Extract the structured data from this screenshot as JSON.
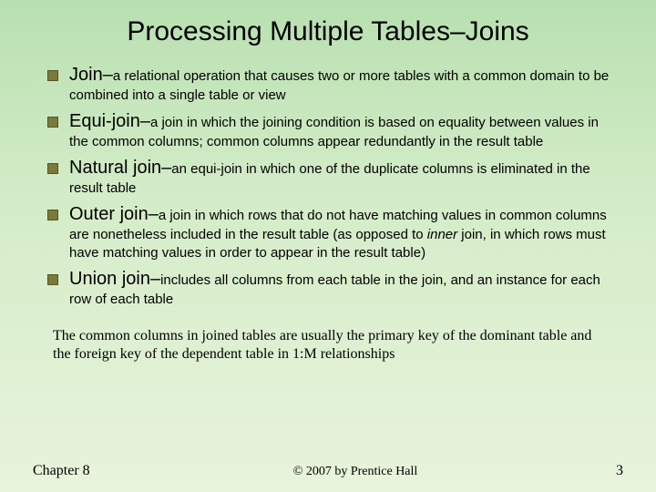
{
  "title": "Processing Multiple Tables–Joins",
  "bullets": [
    {
      "term": "Join–",
      "def": "a relational operation that causes two or more tables with a common domain to be combined into a single table or view"
    },
    {
      "term": "Equi-join–",
      "def": "a join in which the joining condition is based on equality between values in the common columns; common columns appear redundantly in the result table"
    },
    {
      "term": "Natural join–",
      "def": "an equi-join in which one of the duplicate columns is eliminated in the result table"
    },
    {
      "term": "Outer join–",
      "def_before": "a join in which rows that do not have matching values in common columns are nonetheless included in the result table (as opposed to ",
      "def_italic": "inner",
      "def_after": " join, in which rows must have matching values in order to appear in the result table)"
    },
    {
      "term": "Union join–",
      "def": "includes all columns from each table in the join, and an instance for each row of each table"
    }
  ],
  "note": "The common columns in joined tables are usually the primary key of the dominant table and the foreign key of the dependent table in 1:M relationships",
  "footer": {
    "chapter": "Chapter 8",
    "copyright": "© 2007 by Prentice Hall",
    "page": "3"
  }
}
